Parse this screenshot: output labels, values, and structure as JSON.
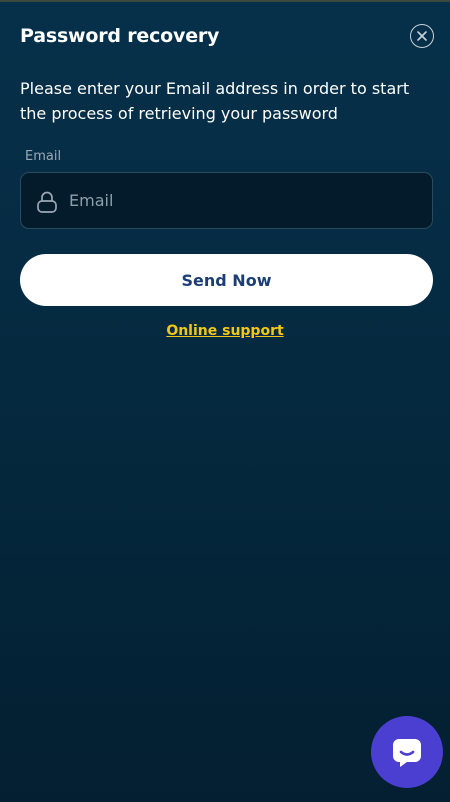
{
  "modal": {
    "title": "Password recovery",
    "description": "Please enter your Email address in order to start the process of retrieving your password",
    "close_icon": "close-icon"
  },
  "form": {
    "email_label": "Email",
    "email_placeholder": "Email",
    "email_value": "",
    "lock_icon": "lock-icon",
    "submit_label": "Send Now"
  },
  "support": {
    "link_text": "Online support"
  },
  "chat": {
    "icon": "chat-bubble-icon"
  },
  "colors": {
    "background": "#052a40",
    "accent_link": "#f2c718",
    "button_bg": "#ffffff",
    "button_text": "#1c3e76",
    "chat_fab": "#4b3fd1"
  }
}
